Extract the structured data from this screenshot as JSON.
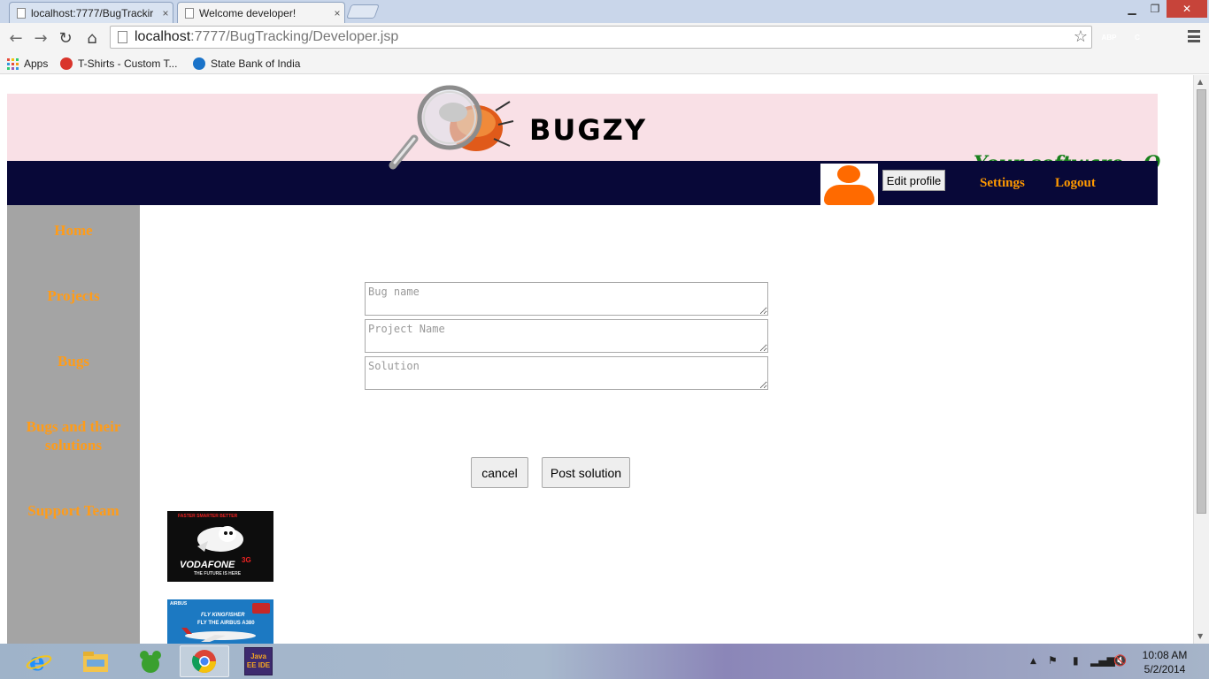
{
  "browser": {
    "tabs": [
      {
        "title": "localhost:7777/BugTrackir",
        "active": false
      },
      {
        "title": "Welcome developer!",
        "active": true
      }
    ],
    "tab_close_glyph": "×",
    "url": {
      "host": "localhost",
      "rest": ":7777/BugTracking/Developer.jsp"
    },
    "bookmarks": [
      {
        "label": "Apps",
        "icon": "apps-grid-icon"
      },
      {
        "label": "T-Shirts - Custom T...",
        "icon": "tshirt-site-icon"
      },
      {
        "label": "State Bank of India",
        "icon": "sbi-icon"
      }
    ],
    "extensions": [
      {
        "name": "adblock-plus-icon",
        "text": "ABP",
        "color": "#d5312b"
      },
      {
        "name": "extension-c-icon",
        "text": "C",
        "color": "#e0322b"
      },
      {
        "name": "extension-green-icon",
        "text": "",
        "color": "#3aa02f"
      }
    ]
  },
  "header": {
    "brand": "BUGZY",
    "tagline": "Your software , O"
  },
  "navbar": {
    "edit_profile": "Edit profile",
    "settings": "Settings",
    "logout": "Logout"
  },
  "sidebar": {
    "items": [
      {
        "label": "Home"
      },
      {
        "label": "Projects"
      },
      {
        "label": "Bugs"
      },
      {
        "label": "Bugs and their solutions"
      },
      {
        "label": "Support Team"
      }
    ]
  },
  "form": {
    "bug_name": {
      "placeholder": "Bug name",
      "value": ""
    },
    "project_name": {
      "placeholder": "Project Name",
      "value": ""
    },
    "solution": {
      "placeholder": "Solution",
      "value": ""
    },
    "cancel_label": "cancel",
    "post_label": "Post solution"
  },
  "ads": [
    {
      "brand": "VODAFONE",
      "tag": "3G",
      "tagline": "THE FUTURE IS HERE",
      "headline": "FASTER SMARTER BETTER"
    },
    {
      "brand": "FLY KINGFISHER",
      "tagline": "FLY THE AIRBUS A380",
      "corner": "AIRBUS"
    }
  ],
  "taskbar": {
    "time": "10:08 AM",
    "date": "5/2/2014",
    "pinned": [
      "internet-explorer-icon",
      "file-explorer-icon",
      "green-app-icon",
      "chrome-icon",
      "java-ee-ide-icon"
    ],
    "java_label": "Java EE IDE"
  },
  "colors": {
    "banner_bg": "#f9e0e6",
    "navbar_bg": "#080838",
    "sidebar_bg": "#a4a4a4",
    "link_orange": "#ff9900",
    "tagline_green": "#18801c",
    "avatar_orange": "#ff6a00"
  }
}
